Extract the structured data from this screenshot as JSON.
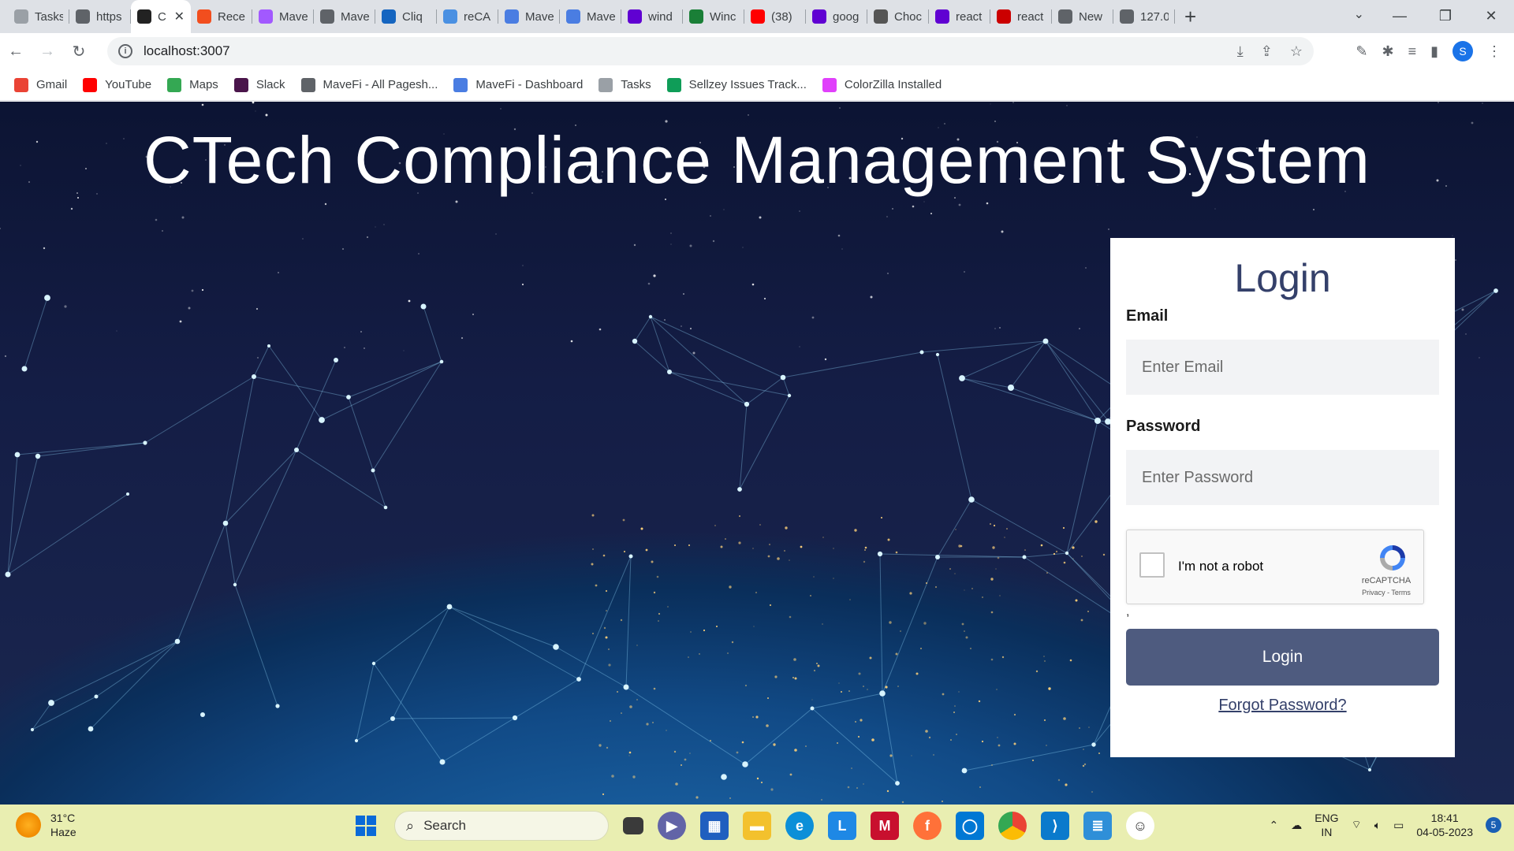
{
  "browser": {
    "tabs": [
      {
        "label": "Tasks",
        "icon": "tasks-favicon",
        "color": "#9aa0a6"
      },
      {
        "label": "https",
        "icon": "globe-favicon",
        "color": "#5f6368"
      },
      {
        "label": "C",
        "icon": "react-favicon",
        "color": "#222222",
        "active": true
      },
      {
        "label": "Rece",
        "icon": "figma-favicon",
        "color": "#f24e1e"
      },
      {
        "label": "Mave",
        "icon": "figma-favicon",
        "color": "#a259ff"
      },
      {
        "label": "Mave",
        "icon": "globe-favicon",
        "color": "#5f6368"
      },
      {
        "label": "Cliq",
        "icon": "cliq-favicon",
        "color": "#1565c0"
      },
      {
        "label": "reCA",
        "icon": "recaptcha-favicon",
        "color": "#4a90e2"
      },
      {
        "label": "Mave",
        "icon": "mavefi-favicon",
        "color": "#4a7de2"
      },
      {
        "label": "Mave",
        "icon": "mavefi-favicon",
        "color": "#4a7de2"
      },
      {
        "label": "wind",
        "icon": "yahoo-favicon",
        "color": "#6001d2"
      },
      {
        "label": "Winc",
        "icon": "w-favicon",
        "color": "#1a7f37"
      },
      {
        "label": "(38)",
        "icon": "youtube-favicon",
        "color": "#ff0000"
      },
      {
        "label": "goog",
        "icon": "yahoo-favicon",
        "color": "#6001d2"
      },
      {
        "label": "Choc",
        "icon": "code-favicon",
        "color": "#555555"
      },
      {
        "label": "react",
        "icon": "yahoo-favicon",
        "color": "#6001d2"
      },
      {
        "label": "react",
        "icon": "npm-favicon",
        "color": "#cb0000"
      },
      {
        "label": "New",
        "icon": "globe-favicon",
        "color": "#5f6368"
      },
      {
        "label": "127.0",
        "icon": "globe-favicon",
        "color": "#5f6368"
      }
    ],
    "url": "localhost:3007",
    "profile_initial": "S"
  },
  "bookmarks": [
    {
      "label": "Gmail",
      "icon": "gmail-icon",
      "color": "#ea4335"
    },
    {
      "label": "YouTube",
      "icon": "youtube-icon",
      "color": "#ff0000"
    },
    {
      "label": "Maps",
      "icon": "maps-icon",
      "color": "#34a853"
    },
    {
      "label": "Slack",
      "icon": "slack-icon",
      "color": "#4a154b"
    },
    {
      "label": "MaveFi - All Pagesh...",
      "icon": "globe-icon",
      "color": "#5f6368"
    },
    {
      "label": "MaveFi - Dashboard",
      "icon": "mavefi-icon",
      "color": "#4a7de2"
    },
    {
      "label": "Tasks",
      "icon": "tasks-icon",
      "color": "#9aa0a6"
    },
    {
      "label": "Sellzey Issues Track...",
      "icon": "sheets-icon",
      "color": "#0f9d58"
    },
    {
      "label": "ColorZilla Installed",
      "icon": "colorzilla-icon",
      "color": "#e040fb"
    }
  ],
  "page": {
    "title": "CTech Compliance Management System",
    "login": {
      "heading": "Login",
      "email_label": "Email",
      "email_placeholder": "Enter Email",
      "password_label": "Password",
      "password_placeholder": "Enter Password",
      "recaptcha_label": "I'm not a robot",
      "recaptcha_brand": "reCAPTCHA",
      "recaptcha_terms": "Privacy - Terms",
      "stray_text": ",",
      "button_label": "Login",
      "forgot_label": "Forgot Password?"
    },
    "accent_color": "#34406a",
    "button_color": "#4e5b7f"
  },
  "taskbar": {
    "weather_temp": "31°C",
    "weather_desc": "Haze",
    "search_label": "Search",
    "language_top": "ENG",
    "language_bottom": "IN",
    "time": "18:41",
    "date": "04-05-2023",
    "notification_count": "5"
  }
}
